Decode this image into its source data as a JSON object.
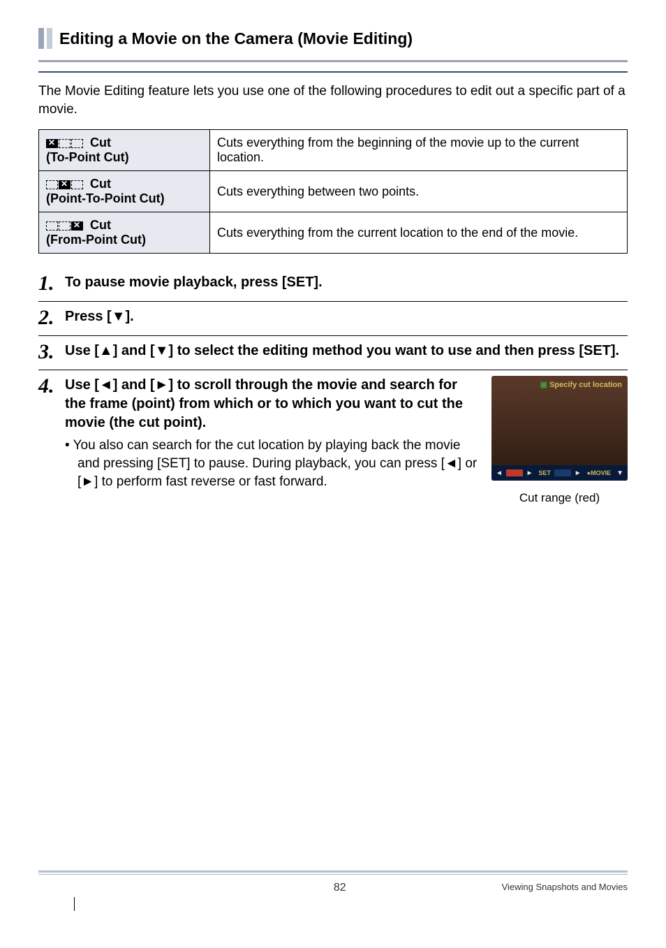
{
  "section": {
    "title": "Editing a Movie on the Camera (Movie Editing)"
  },
  "intro": "The Movie Editing feature lets you use one of the following procedures to edit out a specific part of a movie.",
  "cut_table": {
    "rows": [
      {
        "label_suffix": "Cut",
        "sub": "(To-Point Cut)",
        "desc": "Cuts everything from the beginning of the movie up to the current location."
      },
      {
        "label_suffix": "Cut",
        "sub": "(Point-To-Point Cut)",
        "desc": "Cuts everything between two points."
      },
      {
        "label_suffix": "Cut",
        "sub": "(From-Point Cut)",
        "desc": "Cuts everything from the current location to the end of the movie."
      }
    ]
  },
  "steps": {
    "s1": {
      "num": "1.",
      "text": "To pause movie playback, press [SET]."
    },
    "s2": {
      "num": "2.",
      "prefix": "Press [",
      "glyph": "▼",
      "suffix": "]."
    },
    "s3": {
      "num": "3.",
      "p1": "Use [",
      "g1": "▲",
      "p2": "] and [",
      "g2": "▼",
      "p3": "] to select the editing method you want to use and then press [SET]."
    },
    "s4": {
      "num": "4.",
      "p1": "Use [",
      "g1": "◄",
      "p2": "] and [",
      "g2": "►",
      "p3": "] to scroll through the movie and search for the frame (point) from which or to which you want to cut the movie (the cut point).",
      "bullet": "• You also can search for the cut location by playing back the movie and pressing [SET] to pause. During playback, you can press [◄] or [►] to perform fast reverse or fast forward."
    }
  },
  "preview": {
    "top": "Specify cut location",
    "caption": "Cut range (red)"
  },
  "footer": {
    "page": "82",
    "text": "Viewing Snapshots and Movies"
  }
}
